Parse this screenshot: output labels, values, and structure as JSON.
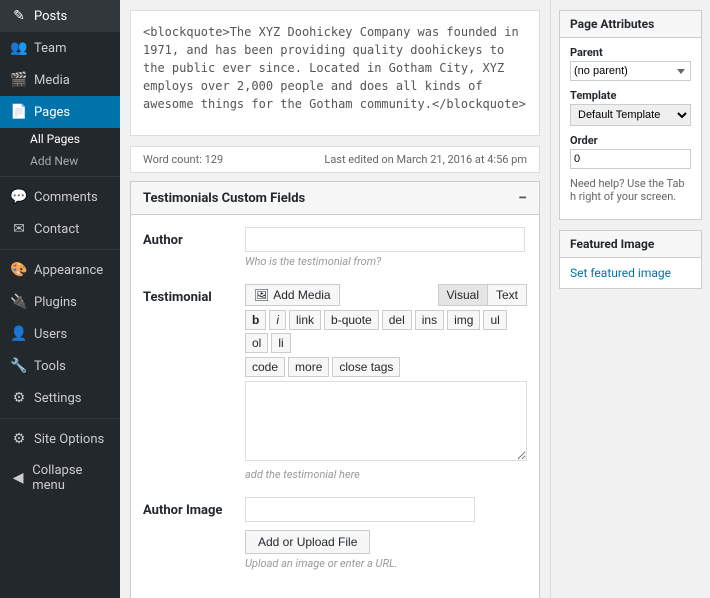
{
  "sidebar": {
    "items": [
      {
        "id": "posts",
        "label": "Posts",
        "icon": "✎"
      },
      {
        "id": "team",
        "label": "Team",
        "icon": "👥"
      },
      {
        "id": "media",
        "label": "Media",
        "icon": "🎬"
      },
      {
        "id": "pages",
        "label": "Pages",
        "icon": "📄",
        "active": true
      },
      {
        "id": "comments",
        "label": "Comments",
        "icon": "💬"
      },
      {
        "id": "contact",
        "label": "Contact",
        "icon": "✉"
      },
      {
        "id": "appearance",
        "label": "Appearance",
        "icon": "🎨"
      },
      {
        "id": "plugins",
        "label": "Plugins",
        "icon": "🔌"
      },
      {
        "id": "users",
        "label": "Users",
        "icon": "👤"
      },
      {
        "id": "tools",
        "label": "Tools",
        "icon": "🔧"
      },
      {
        "id": "settings",
        "label": "Settings",
        "icon": "⚙"
      },
      {
        "id": "site-options",
        "label": "Site Options",
        "icon": "⚙"
      },
      {
        "id": "collapse",
        "label": "Collapse menu",
        "icon": "◀"
      }
    ],
    "sub_items": [
      {
        "id": "all-pages",
        "label": "All Pages"
      },
      {
        "id": "add-new",
        "label": "Add New"
      }
    ]
  },
  "content": {
    "blockquote_text": "<blockquote>The XYZ Doohickey Company was founded in 1971, and has been providing quality doohickeys to the public ever since. Located in Gotham City, XYZ employs over 2,000 people and does all kinds of awesome things for the Gotham community.</blockquote>",
    "word_count_label": "Word count: 129",
    "last_edited_label": "Last edited on March 21, 2016 at 4:56 pm"
  },
  "custom_fields_box": {
    "title": "Testimonials Custom Fields",
    "toggle": "−",
    "author_label": "Author",
    "author_placeholder": "",
    "author_hint": "Who is the testimonial from?",
    "testimonial_label": "Testimonial",
    "add_media_label": "Add Media",
    "visual_btn": "Visual",
    "text_btn": "Text",
    "format_buttons": [
      "b",
      "i",
      "link",
      "b-quote",
      "del",
      "ins",
      "img",
      "ul",
      "ol",
      "li",
      "code",
      "more",
      "close tags"
    ],
    "editor_placeholder": "add the testimonial here",
    "author_image_label": "Author Image",
    "author_image_input": "",
    "upload_btn_label": "Add or Upload File",
    "upload_hint": "Upload an image or enter a URL."
  },
  "right_sidebar": {
    "page_attributes_title": "Page Attributes",
    "parent_label": "Parent",
    "parent_value": "(no parent)",
    "template_label": "Template",
    "template_value": "Default Template",
    "order_label": "Order",
    "order_value": "0",
    "help_text": "Need help? Use the Tab h right of your screen.",
    "featured_image_title": "Featured Image",
    "set_featured_image_link": "Set featured image"
  }
}
